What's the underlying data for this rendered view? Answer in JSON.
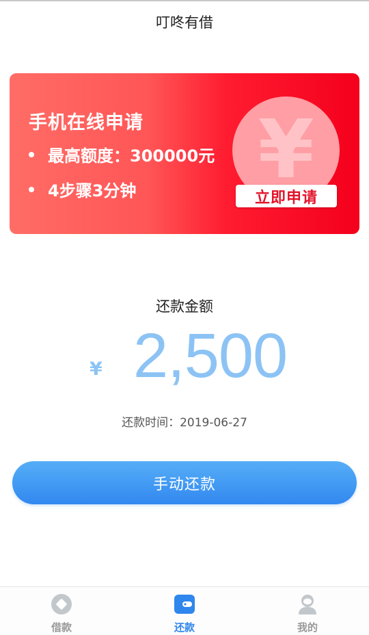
{
  "header": {
    "title": "叮咚有借"
  },
  "banner": {
    "title": "手机在线申请",
    "bullets": [
      "最高额度：300000元",
      "4步骤3分钟"
    ],
    "yen_symbol": "¥",
    "apply_label": "立即申请",
    "colors": {
      "start": "#ff6d66",
      "end": "#f4001c"
    }
  },
  "repayment": {
    "label": "还款金额",
    "currency": "¥",
    "amount": "2,500",
    "due_text": "还款时间：2019-06-27",
    "button_label": "手动还款"
  },
  "tabbar": {
    "tabs": [
      {
        "label": "借款",
        "icon": "loan-icon",
        "active": false
      },
      {
        "label": "还款",
        "icon": "wallet-icon",
        "active": true
      },
      {
        "label": "我的",
        "icon": "user-icon",
        "active": false
      }
    ]
  },
  "colors": {
    "accent": "#2f86ec",
    "amount": "#8cc3f4",
    "inactive": "#999999"
  }
}
